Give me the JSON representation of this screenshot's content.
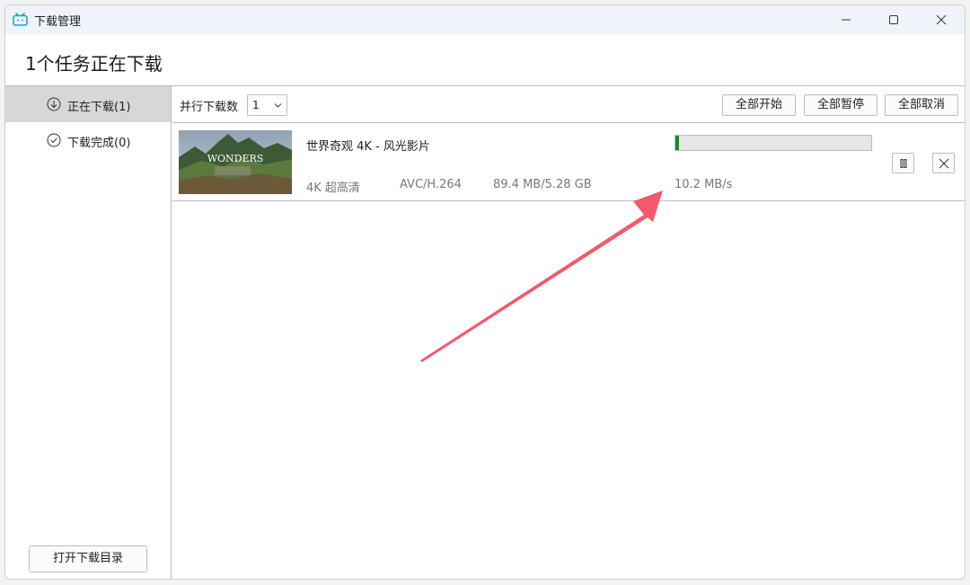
{
  "window": {
    "title": "下载管理",
    "icon": "bilibili-tv-icon",
    "controls": [
      "minimize-icon",
      "maximize-icon",
      "close-icon"
    ]
  },
  "header": {
    "title": "1个任务正在下载"
  },
  "sidebar": {
    "items": [
      {
        "label": "正在下载(1)",
        "icon": "download-circle-icon",
        "active": true
      },
      {
        "label": "下载完成(0)",
        "icon": "check-circle-icon",
        "active": false
      }
    ],
    "open_dir_label": "打开下载目录"
  },
  "toolbar": {
    "parallel_label": "并行下载数",
    "parallel_value": "1",
    "start_all_label": "全部开始",
    "pause_all_label": "全部暂停",
    "cancel_all_label": "全部取消"
  },
  "downloads": [
    {
      "title": "世界奇观 4K - 风光影片",
      "thumbnail_text": "WONDERS",
      "quality": "4K 超高清",
      "codec": "AVC/H.264",
      "size": "89.4 MB/5.28 GB",
      "speed": "10.2 MB/s",
      "progress": 0.017,
      "actions": [
        "pause-icon",
        "close-icon"
      ]
    }
  ],
  "colors": {
    "titlebar": "#f0f4fa",
    "progress_fill": "#1c8a2c",
    "active_sidebar": "#d7d7d7",
    "arrow": "#f25a6b"
  }
}
